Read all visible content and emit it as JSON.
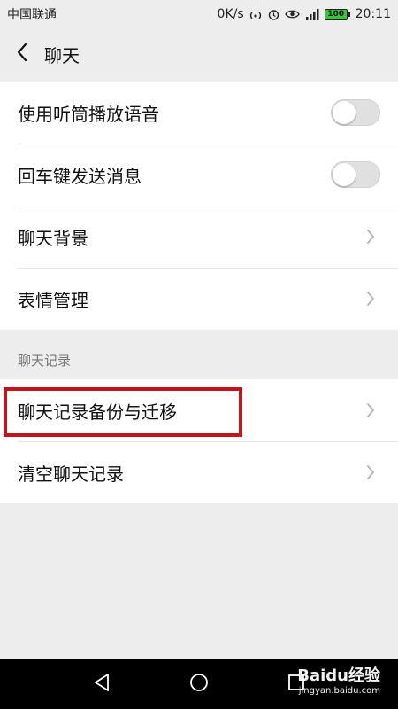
{
  "status_bar": {
    "carrier": "中国联通",
    "speed": "0K/s",
    "battery": "100",
    "time": "20:11"
  },
  "header": {
    "title": "聊天"
  },
  "settings": [
    {
      "label": "使用听筒播放语音",
      "control": "toggle",
      "on": false
    },
    {
      "label": "回车键发送消息",
      "control": "toggle",
      "on": false
    },
    {
      "label": "聊天背景",
      "control": "chevron"
    },
    {
      "label": "表情管理",
      "control": "chevron"
    }
  ],
  "chat_history": {
    "section_title": "聊天记录",
    "items": [
      {
        "label": "聊天记录备份与迁移",
        "highlighted": true
      },
      {
        "label": "清空聊天记录"
      }
    ]
  },
  "watermark": {
    "brand": "Baidu经验",
    "site": "jingyan.baidu.com"
  },
  "colors": {
    "background": "#ededed",
    "highlight": "#c0151c",
    "toggle_off": "#e0e0e0",
    "battery": "#3cc43c"
  }
}
